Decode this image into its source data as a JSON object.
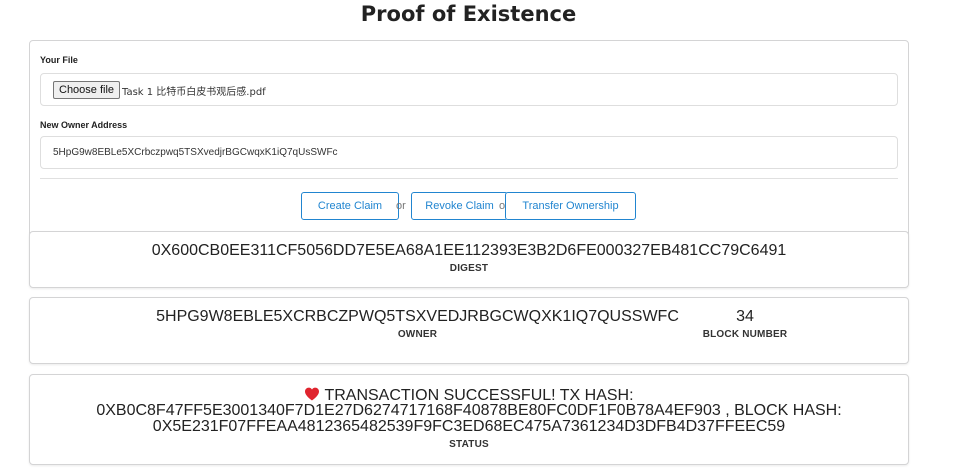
{
  "page": {
    "title": "Proof of Existence"
  },
  "form": {
    "file_label": "Your File",
    "choose_file_label": "Choose file",
    "file_name": "Task 1 比特币白皮书观后感.pdf",
    "owner_label": "New Owner Address",
    "owner_value": "5HpG9w8EBLe5XCrbczpwq5TSXvedjrBGCwqxK1iQ7qUsSWFc"
  },
  "actions": {
    "create_claim": "Create Claim",
    "revoke_claim": "Revoke Claim",
    "transfer_ownership": "Transfer Ownership",
    "or": "or"
  },
  "digest": {
    "value": "0X600CB0EE311CF5056DD7E5EA68A1EE112393E3B2D6FE000327EB481CC79C6491",
    "caption": "DIGEST"
  },
  "owner": {
    "value": "5HPG9W8EBLE5XCRBCZPWQ5TSXVEDJRBGCWQXK1IQ7QUSSWFC",
    "caption": "OWNER",
    "block_number": "34",
    "block_caption": "BLOCK NUMBER"
  },
  "status": {
    "line1": "TRANSACTION SUCCESSFUL! TX HASH:",
    "line2": "0XB0C8F47FF5E3001340F7D1E27D6274717168F40878BE80FC0DF1F0B78A4EF903 , BLOCK HASH:",
    "line3": "0X5E231F07FFEAA4812365482539F9FC3ED68EC475A7361234D3DFB4D37FFEEC59",
    "caption": "STATUS",
    "icon": "heart-icon",
    "icon_color": "#e0242e"
  },
  "colors": {
    "accent": "#2185d0",
    "border": "#d4d4d5"
  }
}
